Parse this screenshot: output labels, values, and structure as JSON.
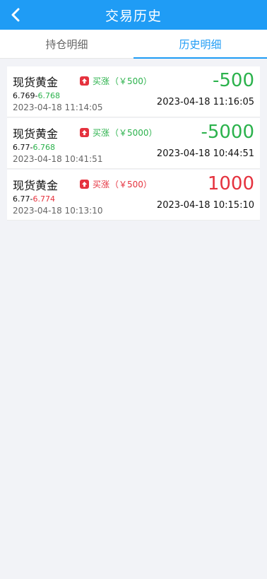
{
  "header": {
    "title": "交易历史",
    "bg_color": "#1f9cf5",
    "back_icon": "chevron-left-icon"
  },
  "tabs": [
    {
      "label": "持仓明细",
      "active": false
    },
    {
      "label": "历史明细",
      "active": true
    }
  ],
  "colors": {
    "profit": "#e5323e",
    "loss": "#2bb24c"
  },
  "trades": [
    {
      "name": "现货黄金",
      "direction_icon": "arrow-up-icon",
      "direction_label": "买涨",
      "amount": "（￥500）",
      "direction_color": "green",
      "open_price": "6.769",
      "close_price": "6.768",
      "close_price_color": "green",
      "open_time": "2023-04-18 11:14:05",
      "pnl": "-500",
      "pnl_color": "green",
      "close_time": "2023-04-18 11:16:05"
    },
    {
      "name": "现货黄金",
      "direction_icon": "arrow-up-icon",
      "direction_label": "买涨",
      "amount": "（￥5000）",
      "direction_color": "green",
      "open_price": "6.77",
      "close_price": "6.768",
      "close_price_color": "green",
      "open_time": "2023-04-18 10:41:51",
      "pnl": "-5000",
      "pnl_color": "green",
      "close_time": "2023-04-18 10:44:51"
    },
    {
      "name": "现货黄金",
      "direction_icon": "arrow-up-icon",
      "direction_label": "买涨",
      "amount": "（￥500）",
      "direction_color": "red",
      "open_price": "6.77",
      "close_price": "6.774",
      "close_price_color": "red",
      "open_time": "2023-04-18 10:13:10",
      "pnl": "1000",
      "pnl_color": "red",
      "close_time": "2023-04-18 10:15:10"
    }
  ]
}
